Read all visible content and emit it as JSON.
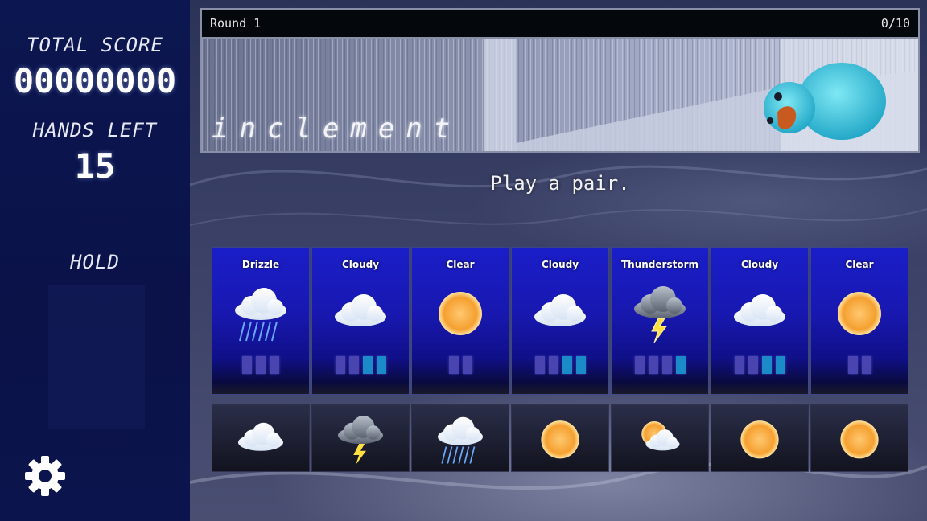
{
  "sidebar": {
    "total_score_label": "TOTAL SCORE",
    "total_score_value": "00000000",
    "hands_left_label": "HANDS LEFT",
    "hands_left_value": "15",
    "hold_label": "HOLD"
  },
  "banner": {
    "round_label": "Round 1",
    "progress": "0/10",
    "title": "inclement"
  },
  "prompt": "Play a pair.",
  "hand": [
    {
      "name": "Drizzle",
      "icon": "rain-cloud-icon",
      "pips": [
        "purple",
        "purple",
        "purple"
      ]
    },
    {
      "name": "Cloudy",
      "icon": "cloud-icon",
      "pips": [
        "purple",
        "purple",
        "teal",
        "teal"
      ]
    },
    {
      "name": "Clear",
      "icon": "sun-icon",
      "pips": [
        "purple",
        "purple"
      ]
    },
    {
      "name": "Cloudy",
      "icon": "cloud-icon",
      "pips": [
        "purple",
        "purple",
        "teal",
        "teal"
      ]
    },
    {
      "name": "Thunderstorm",
      "icon": "thunderstorm-icon",
      "pips": [
        "purple",
        "purple",
        "purple",
        "teal"
      ]
    },
    {
      "name": "Cloudy",
      "icon": "cloud-icon",
      "pips": [
        "purple",
        "purple",
        "teal",
        "teal"
      ]
    },
    {
      "name": "Clear",
      "icon": "sun-icon",
      "pips": [
        "purple",
        "purple"
      ]
    }
  ],
  "deck_preview": [
    {
      "icon": "cloud-icon"
    },
    {
      "icon": "thunderstorm-icon"
    },
    {
      "icon": "rain-cloud-icon"
    },
    {
      "icon": "sun-icon"
    },
    {
      "icon": "partly-sunny-icon"
    },
    {
      "icon": "sun-icon"
    },
    {
      "icon": "sun-icon"
    }
  ],
  "colors": {
    "sidebar": "#0c1650",
    "card_top": "#1a1ec8",
    "pip_purple": "#4a44b0",
    "pip_teal": "#1a8ac8"
  }
}
